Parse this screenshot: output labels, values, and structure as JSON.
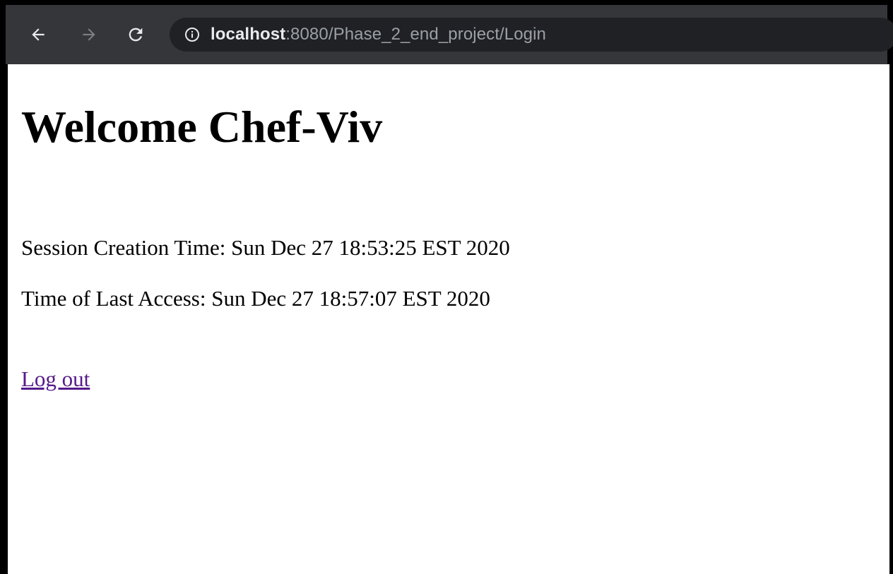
{
  "browser": {
    "url_host": "localhost",
    "url_rest": ":8080/Phase_2_end_project/Login",
    "back_icon": "arrow-left-icon",
    "forward_icon": "arrow-right-icon",
    "reload_icon": "reload-icon",
    "info_icon": "info-circle-icon"
  },
  "page": {
    "heading": "Welcome Chef-Viv",
    "session_creation": "Session Creation Time: Sun Dec 27 18:53:25 EST 2020",
    "last_access": "Time of Last Access: Sun Dec 27 18:57:07 EST 2020",
    "logout_label": "Log out"
  },
  "colors": {
    "toolbar": "#35363a",
    "omnibox": "#202124",
    "visited_link": "#551a8b"
  }
}
